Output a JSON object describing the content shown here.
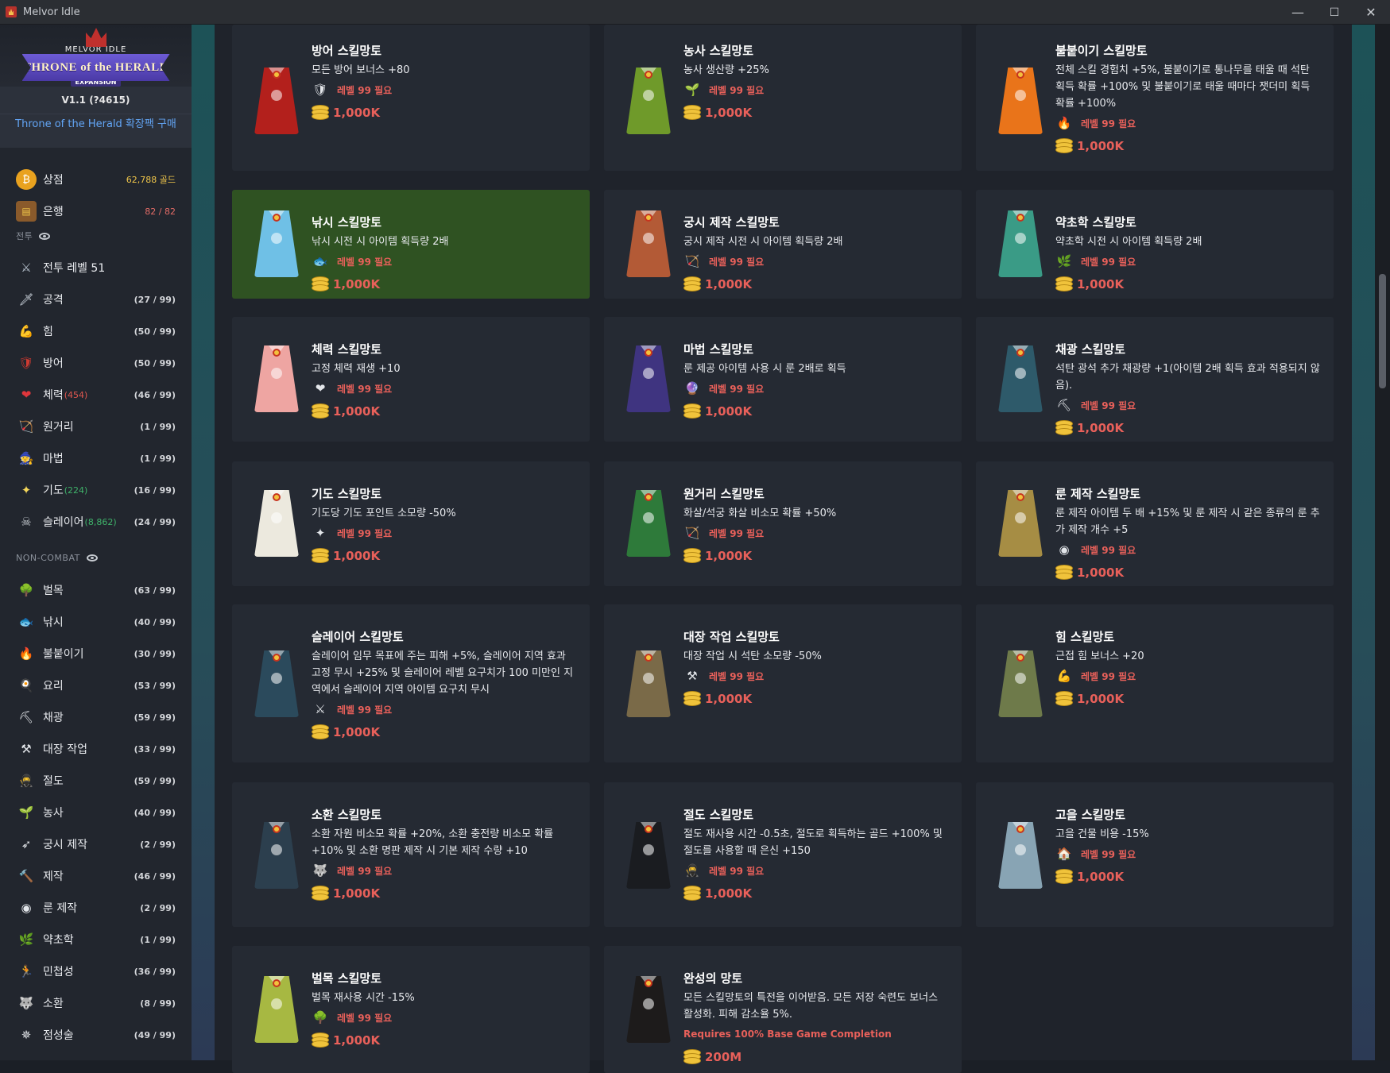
{
  "window": {
    "title": "Melvor Idle"
  },
  "sidebar": {
    "logo": {
      "top": "MELVOR IDLE",
      "banner": "THRONE of the HERALD",
      "badge": "EXPANSION"
    },
    "version": "V1.1 (?4615)",
    "buy_expansion": "Throne of the Herald 확장팩 구매",
    "shop": {
      "label": "상점",
      "count": "62,788 골드"
    },
    "bank": {
      "label": "은행",
      "count": "82 / 82"
    },
    "combat_header": "전투",
    "noncombat_header": "NON-COMBAT",
    "combat": [
      {
        "label": "전투 레벨 51",
        "extra": "",
        "count": ""
      },
      {
        "label": "공격",
        "extra": "",
        "count": "(27 / 99)"
      },
      {
        "label": "힘",
        "extra": "",
        "count": "(50 / 99)"
      },
      {
        "label": "방어",
        "extra": "",
        "count": "(50 / 99)"
      },
      {
        "label": "체력",
        "extra": "(454)",
        "count": "(46 / 99)"
      },
      {
        "label": "원거리",
        "extra": "",
        "count": "(1 / 99)"
      },
      {
        "label": "마법",
        "extra": "",
        "count": "(1 / 99)"
      },
      {
        "label": "기도",
        "extra": "(224)",
        "count": "(16 / 99)"
      },
      {
        "label": "슬레이어",
        "extra": "(8,862)",
        "count": "(24 / 99)"
      }
    ],
    "noncombat": [
      {
        "label": "벌목",
        "count": "(63 / 99)"
      },
      {
        "label": "낚시",
        "count": "(40 / 99)"
      },
      {
        "label": "불붙이기",
        "count": "(30 / 99)"
      },
      {
        "label": "요리",
        "count": "(53 / 99)"
      },
      {
        "label": "채광",
        "count": "(59 / 99)"
      },
      {
        "label": "대장 작업",
        "count": "(33 / 99)"
      },
      {
        "label": "절도",
        "count": "(59 / 99)"
      },
      {
        "label": "농사",
        "count": "(40 / 99)"
      },
      {
        "label": "궁시 제작",
        "count": "(2 / 99)"
      },
      {
        "label": "제작",
        "count": "(46 / 99)"
      },
      {
        "label": "룬 제작",
        "count": "(2 / 99)"
      },
      {
        "label": "약초학",
        "count": "(1 / 99)"
      },
      {
        "label": "민첩성",
        "count": "(36 / 99)"
      },
      {
        "label": "소환",
        "count": "(8 / 99)"
      },
      {
        "label": "점성술",
        "count": "(49 / 99)"
      }
    ]
  },
  "shop": {
    "items": [
      {
        "name": "방어 스킬망토",
        "desc": "모든 방어 보너스 +80",
        "req": "레벨 99 필요",
        "cost": "1,000K",
        "color": "#b3201c",
        "req_icon": "🛡"
      },
      {
        "name": "농사 스킬망토",
        "desc": "농사 생산량 +25%",
        "req": "레벨 99 필요",
        "cost": "1,000K",
        "color": "#6f9a2a",
        "req_icon": "🌱"
      },
      {
        "name": "불붙이기 스킬망토",
        "desc": "전체 스킬 경험치 +5%, 불붙이기로 통나무를 태울 때 석탄 획득 확률 +100% 및 불붙이기로 태울 때마다 잿더미 획득 확률 +100%",
        "req": "레벨 99 필요",
        "cost": "1,000K",
        "color": "#e9741a",
        "req_icon": "🔥"
      },
      {
        "name": "낚시 스킬망토",
        "desc": "낚시 시전 시 아이템 획득량 2배",
        "req": "레벨 99 필요",
        "cost": "1,000K",
        "color": "#6fc0e6",
        "req_icon": "🐟"
      },
      {
        "name": "궁시 제작 스킬망토",
        "desc": "궁시 제작 시전 시 아이템 획득량 2배",
        "req": "레벨 99 필요",
        "cost": "1,000K",
        "color": "#b35a36",
        "req_icon": "🏹"
      },
      {
        "name": "약초학 스킬망토",
        "desc": "약초학 시전 시 아이템 획득량 2배",
        "req": "레벨 99 필요",
        "cost": "1,000K",
        "color": "#3a9b86",
        "req_icon": "🌿"
      },
      {
        "name": "체력 스킬망토",
        "desc": "고정 체력 재생 +10",
        "req": "레벨 99 필요",
        "cost": "1,000K",
        "color": "#eea5a2",
        "req_icon": "❤"
      },
      {
        "name": "마법 스킬망토",
        "desc": "룬 제공 아이템 사용 시 룬 2배로 획득",
        "req": "레벨 99 필요",
        "cost": "1,000K",
        "color": "#3f3480",
        "req_icon": "🔮"
      },
      {
        "name": "채광 스킬망토",
        "desc": "석탄 광석 추가 채광량 +1(아이템 2배 획득 효과 적용되지 않음).",
        "req": "레벨 99 필요",
        "cost": "1,000K",
        "color": "#2e5a6a",
        "req_icon": "⛏"
      },
      {
        "name": "기도 스킬망토",
        "desc": "기도당 기도 포인트 소모량 -50%",
        "req": "레벨 99 필요",
        "cost": "1,000K",
        "color": "#ece9de",
        "req_icon": "✦"
      },
      {
        "name": "원거리 스킬망토",
        "desc": "화살/석궁 화살 비소모 확률 +50%",
        "req": "레벨 99 필요",
        "cost": "1,000K",
        "color": "#2e7a3a",
        "req_icon": "🏹"
      },
      {
        "name": "룬 제작 스킬망토",
        "desc": "룬 제작 아이템 두 배 +15% 및 룬 제작 시 같은 종류의 룬 추가 제작 개수 +5",
        "req": "레벨 99 필요",
        "cost": "1,000K",
        "color": "#a68d44",
        "req_icon": "◉"
      },
      {
        "name": "슬레이어 스킬망토",
        "desc": "슬레이어 임무 목표에 주는 피해 +5%, 슬레이어 지역 효과 고정 무시 +25% 및 슬레이어 레벨 요구치가 100 미만인 지역에서 슬레이어 지역 아이템 요구치 무시",
        "req": "레벨 99 필요",
        "cost": "1,000K",
        "color": "#2b4a5c",
        "req_icon": "⚔"
      },
      {
        "name": "대장 작업 스킬망토",
        "desc": "대장 작업 시 석탄 소모량 -50%",
        "req": "레벨 99 필요",
        "cost": "1,000K",
        "color": "#7a6a48",
        "req_icon": "⚒"
      },
      {
        "name": "힘 스킬망토",
        "desc": "근접 힘 보너스 +20",
        "req": "레벨 99 필요",
        "cost": "1,000K",
        "color": "#6e7a4a",
        "req_icon": "💪"
      },
      {
        "name": "소환 스킬망토",
        "desc": "소환 자원 비소모 확률 +20%, 소환 충전량 비소모 확률 +10% 및 소환 명판 제작 시 기본 제작 수량 +10",
        "req": "레벨 99 필요",
        "cost": "1,000K",
        "color": "#2c3f4e",
        "req_icon": "🐺"
      },
      {
        "name": "절도 스킬망토",
        "desc": "절도 재사용 시간 -0.5초, 절도로 획득하는 골드 +100% 및 절도를 사용할 때 은신 +150",
        "req": "레벨 99 필요",
        "cost": "1,000K",
        "color": "#1a1c20",
        "req_icon": "🥷"
      },
      {
        "name": "고을 스킬망토",
        "desc": "고을 건물 비용 -15%",
        "req": "레벨 99 필요",
        "cost": "1,000K",
        "color": "#88a4b4",
        "req_icon": "🏠"
      },
      {
        "name": "벌목 스킬망토",
        "desc": "벌목 재사용 시간 -15%",
        "req": "레벨 99 필요",
        "cost": "1,000K",
        "color": "#a7b842",
        "req_icon": "🌳"
      },
      {
        "name": "완성의 망토",
        "desc": "모든 스킬망토의 특전을 이어받음. 모든 저장 숙련도 보너스 활성화. 피해 감소율 5%.",
        "req": "Requires 100% Base Game Completion",
        "cost": "200M",
        "color": "#1d1b1b",
        "req_icon": ""
      }
    ]
  }
}
